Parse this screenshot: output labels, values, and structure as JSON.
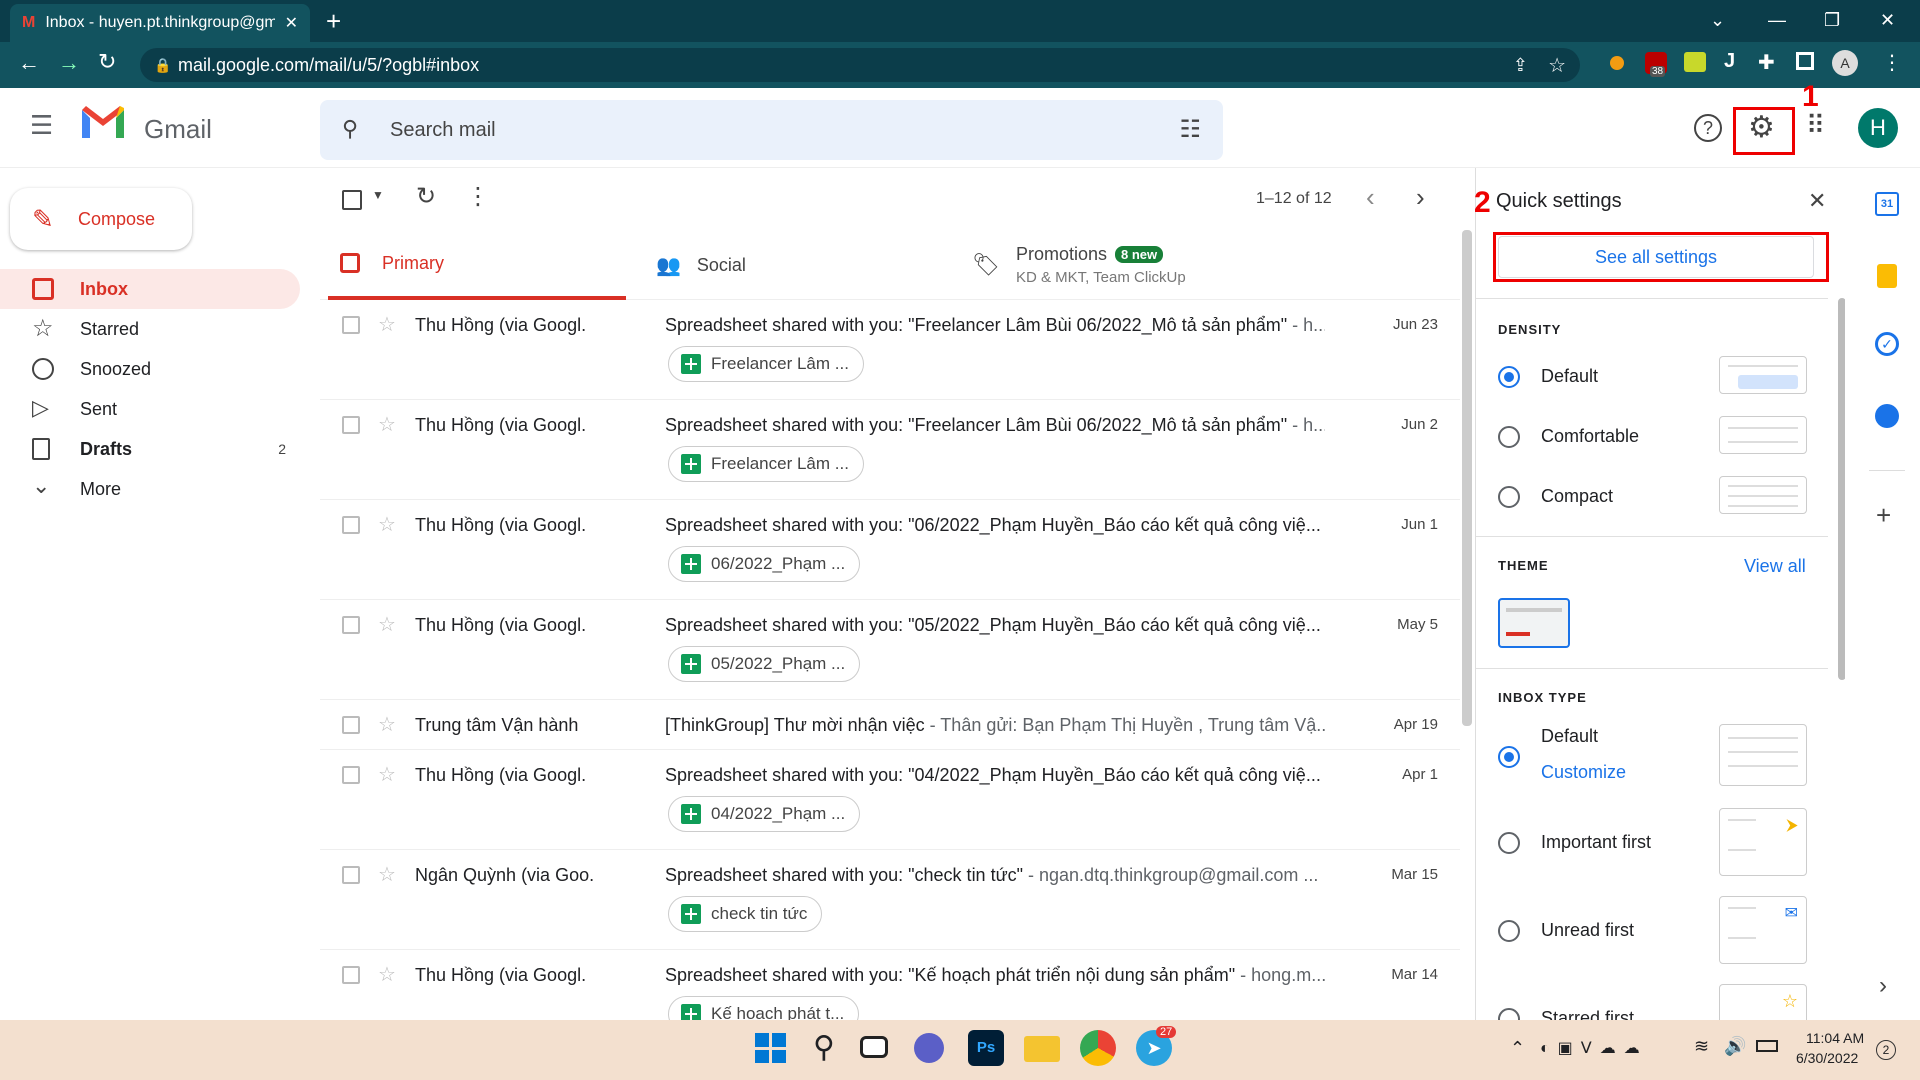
{
  "browser": {
    "tab_title": "Inbox - huyen.pt.thinkgroup@gm",
    "url": "mail.google.com/mail/u/5/?ogbl#inbox",
    "extension_badge": "38",
    "profile_initial": "A"
  },
  "gmail": {
    "logo_text": "Gmail",
    "search_placeholder": "Search mail",
    "avatar_initial": "H",
    "compose_label": "Compose",
    "nav": [
      {
        "label": "Inbox",
        "count": ""
      },
      {
        "label": "Starred",
        "count": ""
      },
      {
        "label": "Snoozed",
        "count": ""
      },
      {
        "label": "Sent",
        "count": ""
      },
      {
        "label": "Drafts",
        "count": "2"
      },
      {
        "label": "More",
        "count": ""
      }
    ],
    "pagination": "1–12 of 12",
    "tabs": {
      "primary": "Primary",
      "social": "Social",
      "promotions": "Promotions",
      "promotions_badge": "8 new",
      "promotions_sub": "KD & MKT, Team ClickUp"
    },
    "emails": [
      {
        "sender": "Thu Hồng (via Googl.",
        "subject": "Spreadsheet shared with you: \"Freelancer Lâm Bùi 06/2022_Mô tả sản phẩm\"",
        "snippet": " - h...",
        "date": "Jun 23",
        "chip": "Freelancer Lâm ..."
      },
      {
        "sender": "Thu Hồng (via Googl.",
        "subject": "Spreadsheet shared with you: \"Freelancer Lâm Bùi 06/2022_Mô tả sản phẩm\"",
        "snippet": " - h...",
        "date": "Jun 2",
        "chip": "Freelancer Lâm ..."
      },
      {
        "sender": "Thu Hồng (via Googl.",
        "subject": "Spreadsheet shared with you: \"06/2022_Phạm Huyền_Báo cáo kết quả công việ...",
        "snippet": "",
        "date": "Jun 1",
        "chip": "06/2022_Phạm ..."
      },
      {
        "sender": "Thu Hồng (via Googl.",
        "subject": "Spreadsheet shared with you: \"05/2022_Phạm Huyền_Báo cáo kết quả công việ...",
        "snippet": "",
        "date": "May 5",
        "chip": "05/2022_Phạm ..."
      },
      {
        "sender": "Trung tâm Vận hành",
        "subject": "[ThinkGroup] Thư mời nhận việc",
        "snippet": " - Thân gửi: Bạn Phạm Thị Huyền , Trung tâm Vậ...",
        "date": "Apr 19",
        "chip": ""
      },
      {
        "sender": "Thu Hồng (via Googl.",
        "subject": "Spreadsheet shared with you: \"04/2022_Phạm Huyền_Báo cáo kết quả công việ...",
        "snippet": "",
        "date": "Apr 1",
        "chip": "04/2022_Phạm ..."
      },
      {
        "sender": "Ngân Quỳnh (via Goo.",
        "subject": "Spreadsheet shared with you: \"check tin tức\"",
        "snippet": " - ngan.dtq.thinkgroup@gmail.com ...",
        "date": "Mar 15",
        "chip": "check tin tức"
      },
      {
        "sender": "Thu Hồng (via Googl.",
        "subject": "Spreadsheet shared with you: \"Kế hoạch phát triển nội dung sản phẩm\"",
        "snippet": " - hong.m...",
        "date": "Mar 14",
        "chip": "Kế hoạch phát t..."
      }
    ]
  },
  "quick_settings": {
    "title": "Quick settings",
    "see_all": "See all settings",
    "density_heading": "DENSITY",
    "density": [
      "Default",
      "Comfortable",
      "Compact"
    ],
    "theme_heading": "THEME",
    "view_all": "View all",
    "inbox_type_heading": "INBOX TYPE",
    "inbox_default": "Default",
    "customize": "Customize",
    "inbox_types": [
      "Important first",
      "Unread first",
      "Starred first"
    ]
  },
  "annotations": {
    "n1": "1",
    "n2": "2"
  },
  "taskbar": {
    "time": "11:04 AM",
    "date": "6/30/2022",
    "telegram_badge": "27",
    "notif_count": "2"
  },
  "colors": {
    "accent_red": "#d93025",
    "blue": "#1a73e8",
    "chrome_bg": "#0b3d4a",
    "sheets_green": "#0f9d58"
  }
}
